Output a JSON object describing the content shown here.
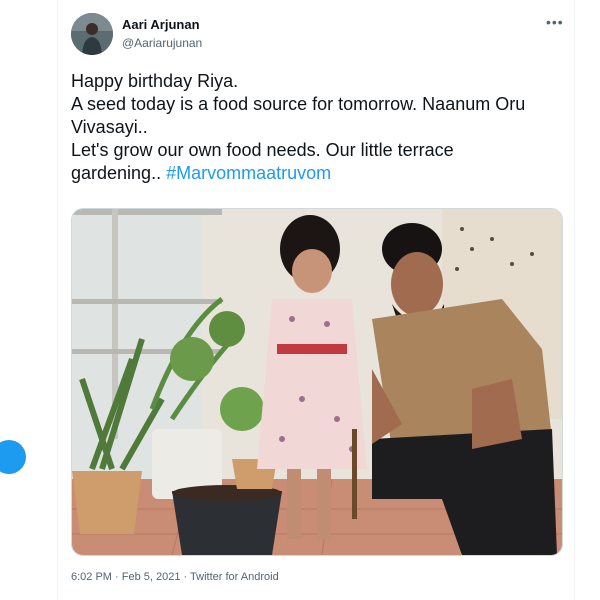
{
  "user": {
    "name": "Aari Arjunan",
    "handle": "@Aariarujunan"
  },
  "more_label": "•••",
  "tweet": {
    "lines": [
      "Happy  birthday Riya.",
      "A seed today is a food source for tomorrow. Naanum Oru Vivasayi..",
      "Let's grow our own food needs. Our little terrace gardening.. "
    ],
    "hashtag": "#Marvommaatruvom"
  },
  "meta": {
    "time": "6:02 PM",
    "sep1": " · ",
    "date": "Feb 5, 2021",
    "sep2": " · ",
    "source": "Twitter for Android"
  },
  "colors": {
    "accent": "#1d9bf0",
    "text": "#0f1419",
    "secondary": "#536471",
    "border": "#eff3f4"
  }
}
